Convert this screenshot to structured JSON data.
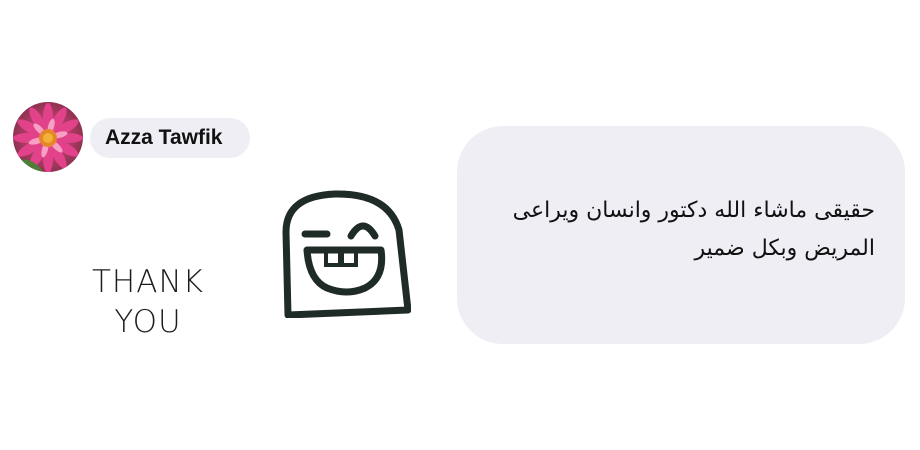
{
  "comment": {
    "author": "Azza Tawfik",
    "avatar_icon": "flower-avatar-icon",
    "message": "حقيقى ماشاء الله دكتور وانسان ويراعى المريض وبكل ضمير"
  },
  "sticker": {
    "text_line1": "THANK",
    "text_line2": "YOU",
    "icon": "grinning-face-icon"
  },
  "colors": {
    "bubble": "#eeeef4",
    "text": "#111111",
    "sticker_stroke": "#1f2b26"
  }
}
